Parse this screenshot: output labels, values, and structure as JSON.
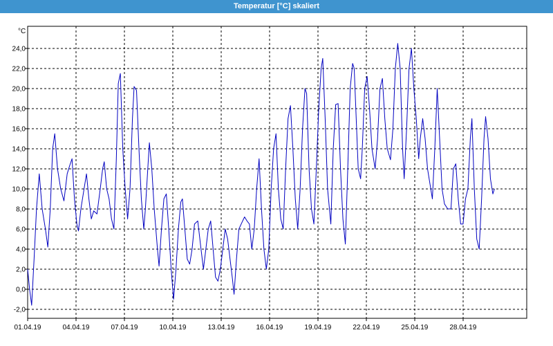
{
  "window": {
    "title": "Temperatur [°C] skaliert"
  },
  "colors": {
    "titlebar": "#3f94cf",
    "series": "#0000c0",
    "grid": "#000000",
    "background": "#ffffff"
  },
  "chart_data": {
    "type": "line",
    "title": "Temperatur [°C] skaliert",
    "ylabel": "°C",
    "ylim": [
      -2.9,
      26.2
    ],
    "xlim": [
      0,
      30.95
    ],
    "x_unit": "days since 01.04.19 00:00",
    "grid": true,
    "grid_style": "dashed",
    "legend": "none",
    "y_ticks": [
      "-2,0",
      "0,0",
      "2,0",
      "4,0",
      "6,0",
      "8,0",
      "10,0",
      "12,0",
      "14,0",
      "16,0",
      "18,0",
      "20,0",
      "22,0",
      "24,0"
    ],
    "x_ticks": [
      "01.04.19",
      "04.04.19",
      "07.04.19",
      "10.04.19",
      "13.04.19",
      "16.04.19",
      "19.04.19",
      "22.04.19",
      "25.04.19",
      "28.04.19"
    ],
    "series": [
      {
        "points": [
          [
            0.0,
            2.0
          ],
          [
            0.12,
            0.0
          ],
          [
            0.25,
            -1.6
          ],
          [
            0.4,
            3.0
          ],
          [
            0.55,
            8.0
          ],
          [
            0.72,
            11.5
          ],
          [
            0.9,
            8.0
          ],
          [
            1.1,
            6.0
          ],
          [
            1.25,
            4.2
          ],
          [
            1.4,
            8.0
          ],
          [
            1.55,
            14.0
          ],
          [
            1.68,
            15.5
          ],
          [
            1.85,
            12.0
          ],
          [
            2.05,
            10.0
          ],
          [
            2.25,
            8.8
          ],
          [
            2.45,
            11.5
          ],
          [
            2.6,
            12.3
          ],
          [
            2.75,
            13.0
          ],
          [
            2.9,
            9.0
          ],
          [
            3.05,
            6.5
          ],
          [
            3.15,
            5.8
          ],
          [
            3.3,
            8.0
          ],
          [
            3.5,
            10.0
          ],
          [
            3.65,
            11.5
          ],
          [
            3.8,
            9.0
          ],
          [
            3.95,
            7.0
          ],
          [
            4.1,
            7.8
          ],
          [
            4.3,
            7.5
          ],
          [
            4.5,
            10.0
          ],
          [
            4.65,
            12.0
          ],
          [
            4.75,
            12.7
          ],
          [
            4.9,
            10.0
          ],
          [
            5.05,
            9.0
          ],
          [
            5.2,
            7.0
          ],
          [
            5.35,
            6.0
          ],
          [
            5.5,
            13.0
          ],
          [
            5.62,
            20.5
          ],
          [
            5.75,
            21.5
          ],
          [
            5.9,
            14.0
          ],
          [
            6.05,
            10.0
          ],
          [
            6.2,
            7.0
          ],
          [
            6.35,
            10.0
          ],
          [
            6.5,
            17.0
          ],
          [
            6.6,
            20.2
          ],
          [
            6.75,
            19.8
          ],
          [
            6.9,
            14.0
          ],
          [
            7.05,
            9.0
          ],
          [
            7.2,
            6.0
          ],
          [
            7.3,
            8.0
          ],
          [
            7.45,
            12.0
          ],
          [
            7.55,
            14.6
          ],
          [
            7.7,
            12.0
          ],
          [
            7.85,
            8.0
          ],
          [
            8.05,
            4.0
          ],
          [
            8.15,
            2.3
          ],
          [
            8.3,
            6.0
          ],
          [
            8.45,
            9.0
          ],
          [
            8.6,
            9.5
          ],
          [
            8.75,
            6.0
          ],
          [
            8.9,
            2.0
          ],
          [
            9.05,
            -1.0
          ],
          [
            9.2,
            2.0
          ],
          [
            9.35,
            6.0
          ],
          [
            9.5,
            8.7
          ],
          [
            9.6,
            9.0
          ],
          [
            9.75,
            6.0
          ],
          [
            9.9,
            3.0
          ],
          [
            10.05,
            2.5
          ],
          [
            10.2,
            4.0
          ],
          [
            10.35,
            6.5
          ],
          [
            10.55,
            6.8
          ],
          [
            10.75,
            4.0
          ],
          [
            10.9,
            2.0
          ],
          [
            11.05,
            4.0
          ],
          [
            11.2,
            6.0
          ],
          [
            11.35,
            6.8
          ],
          [
            11.5,
            4.0
          ],
          [
            11.65,
            1.2
          ],
          [
            11.8,
            0.8
          ],
          [
            11.95,
            2.0
          ],
          [
            12.1,
            4.0
          ],
          [
            12.25,
            6.0
          ],
          [
            12.4,
            5.0
          ],
          [
            12.55,
            3.0
          ],
          [
            12.7,
            1.0
          ],
          [
            12.8,
            -0.5
          ],
          [
            12.95,
            3.0
          ],
          [
            13.1,
            6.0
          ],
          [
            13.3,
            6.7
          ],
          [
            13.45,
            7.2
          ],
          [
            13.6,
            6.8
          ],
          [
            13.75,
            6.5
          ],
          [
            13.9,
            4.0
          ],
          [
            14.05,
            6.0
          ],
          [
            14.2,
            10.0
          ],
          [
            14.35,
            13.0
          ],
          [
            14.5,
            8.0
          ],
          [
            14.65,
            4.0
          ],
          [
            14.8,
            2.0
          ],
          [
            14.95,
            4.0
          ],
          [
            15.1,
            10.0
          ],
          [
            15.25,
            14.0
          ],
          [
            15.4,
            15.5
          ],
          [
            15.55,
            10.0
          ],
          [
            15.7,
            7.0
          ],
          [
            15.85,
            6.0
          ],
          [
            16.0,
            12.0
          ],
          [
            16.15,
            17.0
          ],
          [
            16.3,
            18.3
          ],
          [
            16.45,
            14.0
          ],
          [
            16.6,
            9.0
          ],
          [
            16.75,
            6.0
          ],
          [
            16.9,
            10.0
          ],
          [
            17.05,
            16.0
          ],
          [
            17.2,
            20.0
          ],
          [
            17.3,
            19.5
          ],
          [
            17.45,
            12.0
          ],
          [
            17.6,
            8.0
          ],
          [
            17.75,
            6.5
          ],
          [
            17.9,
            12.0
          ],
          [
            18.05,
            18.0
          ],
          [
            18.2,
            22.0
          ],
          [
            18.3,
            23.0
          ],
          [
            18.45,
            17.0
          ],
          [
            18.6,
            10.0
          ],
          [
            18.8,
            6.5
          ],
          [
            18.95,
            14.0
          ],
          [
            19.1,
            18.4
          ],
          [
            19.25,
            18.5
          ],
          [
            19.4,
            12.0
          ],
          [
            19.55,
            7.0
          ],
          [
            19.7,
            4.5
          ],
          [
            19.85,
            12.0
          ],
          [
            20.0,
            20.0
          ],
          [
            20.15,
            22.5
          ],
          [
            20.25,
            22.0
          ],
          [
            20.4,
            16.0
          ],
          [
            20.5,
            12.0
          ],
          [
            20.65,
            11.0
          ],
          [
            20.75,
            14.0
          ],
          [
            20.9,
            20.0
          ],
          [
            21.05,
            21.2
          ],
          [
            21.2,
            18.0
          ],
          [
            21.35,
            14.0
          ],
          [
            21.55,
            12.0
          ],
          [
            21.7,
            15.0
          ],
          [
            21.85,
            20.0
          ],
          [
            22.0,
            21.0
          ],
          [
            22.15,
            17.0
          ],
          [
            22.3,
            14.0
          ],
          [
            22.5,
            12.9
          ],
          [
            22.65,
            16.0
          ],
          [
            22.8,
            22.0
          ],
          [
            22.95,
            24.5
          ],
          [
            23.1,
            22.0
          ],
          [
            23.25,
            14.0
          ],
          [
            23.35,
            11.0
          ],
          [
            23.5,
            16.0
          ],
          [
            23.65,
            22.0
          ],
          [
            23.8,
            24.0
          ],
          [
            23.95,
            20.0
          ],
          [
            24.1,
            17.0
          ],
          [
            24.25,
            13.0
          ],
          [
            24.35,
            15.0
          ],
          [
            24.5,
            17.0
          ],
          [
            24.65,
            15.0
          ],
          [
            24.8,
            12.0
          ],
          [
            24.95,
            10.5
          ],
          [
            25.1,
            9.0
          ],
          [
            25.25,
            14.0
          ],
          [
            25.4,
            20.0
          ],
          [
            25.55,
            15.0
          ],
          [
            25.7,
            10.0
          ],
          [
            25.85,
            8.5
          ],
          [
            26.05,
            8.0
          ],
          [
            26.25,
            8.0
          ],
          [
            26.4,
            12.0
          ],
          [
            26.55,
            12.5
          ],
          [
            26.7,
            9.0
          ],
          [
            26.85,
            6.5
          ],
          [
            27.0,
            6.5
          ],
          [
            27.15,
            9.0
          ],
          [
            27.3,
            10.0
          ],
          [
            27.45,
            15.0
          ],
          [
            27.55,
            17.0
          ],
          [
            27.7,
            10.0
          ],
          [
            27.85,
            5.0
          ],
          [
            28.0,
            4.0
          ],
          [
            28.15,
            9.0
          ],
          [
            28.3,
            15.0
          ],
          [
            28.4,
            17.2
          ],
          [
            28.55,
            15.0
          ],
          [
            28.7,
            11.0
          ],
          [
            28.85,
            9.5
          ],
          [
            28.95,
            10.0
          ]
        ]
      }
    ]
  }
}
